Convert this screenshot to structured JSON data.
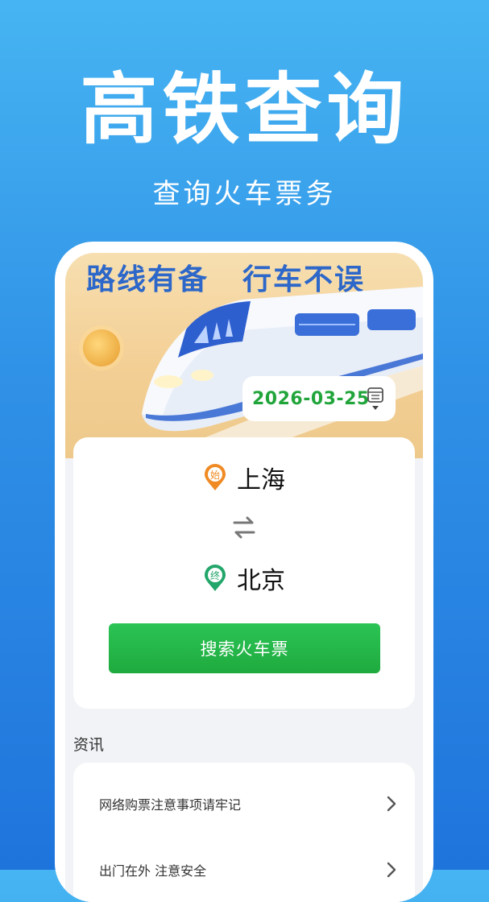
{
  "hero": {
    "title": "高铁查询",
    "subtitle": "查询火车票务"
  },
  "banner": {
    "slogan_left": "路线有备",
    "slogan_right": "行车不误",
    "date": "2026-03-25"
  },
  "route": {
    "from_badge": "始",
    "from_station": "上海",
    "to_badge": "终",
    "to_station": "北京",
    "search_label": "搜索火车票"
  },
  "news": {
    "section_title": "资讯",
    "items": [
      {
        "title": "网络购票注意事项请牢记"
      },
      {
        "title": "出门在外 注意安全"
      }
    ]
  },
  "colors": {
    "background_top": "#46b4f2",
    "background_bottom": "#1f74dc",
    "accent_green": "#21a53b",
    "from_pin": "#f08a24",
    "to_pin": "#22a66a"
  }
}
